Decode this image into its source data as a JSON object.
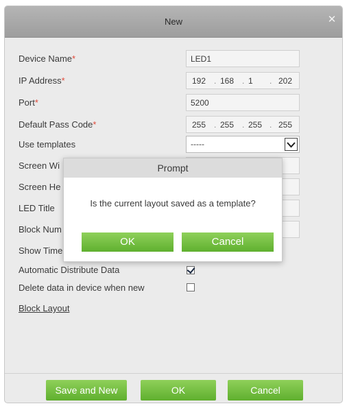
{
  "dialog": {
    "title": "New",
    "close_icon": "close-icon"
  },
  "form": {
    "device_name": {
      "label": "Device Name",
      "required": "*",
      "value": "LED1"
    },
    "ip_address": {
      "label": "IP Address",
      "required": "*",
      "octets": [
        "192",
        "168",
        "1",
        "202"
      ]
    },
    "port": {
      "label": "Port",
      "required": "*",
      "value": "5200"
    },
    "default_pass_code": {
      "label": "Default Pass Code",
      "required": "*",
      "octets": [
        "255",
        "255",
        "255",
        "255"
      ]
    },
    "use_templates": {
      "label": "Use templates",
      "selected": "-----"
    },
    "screen_width": {
      "label": "Screen Wi"
    },
    "screen_height": {
      "label": "Screen He"
    },
    "led_title": {
      "label": "LED Title"
    },
    "block_number": {
      "label": "Block Num"
    },
    "show_time": {
      "label": "Show Time"
    },
    "automatic_distribute": {
      "label": "Automatic Distribute Data",
      "checked": true
    },
    "delete_data": {
      "label": "Delete data in device when new",
      "checked": false
    },
    "block_layout": {
      "label": "Block Layout"
    }
  },
  "footer": {
    "save_and_new": "Save and New",
    "ok": "OK",
    "cancel": "Cancel"
  },
  "prompt": {
    "title": "Prompt",
    "message": "Is the current layout saved as a template?",
    "ok": "OK",
    "cancel": "Cancel"
  },
  "colors": {
    "button_green": "#6cbb3c",
    "required_red": "#e04a3a",
    "titlebar_gray": "#a6a6a6"
  }
}
